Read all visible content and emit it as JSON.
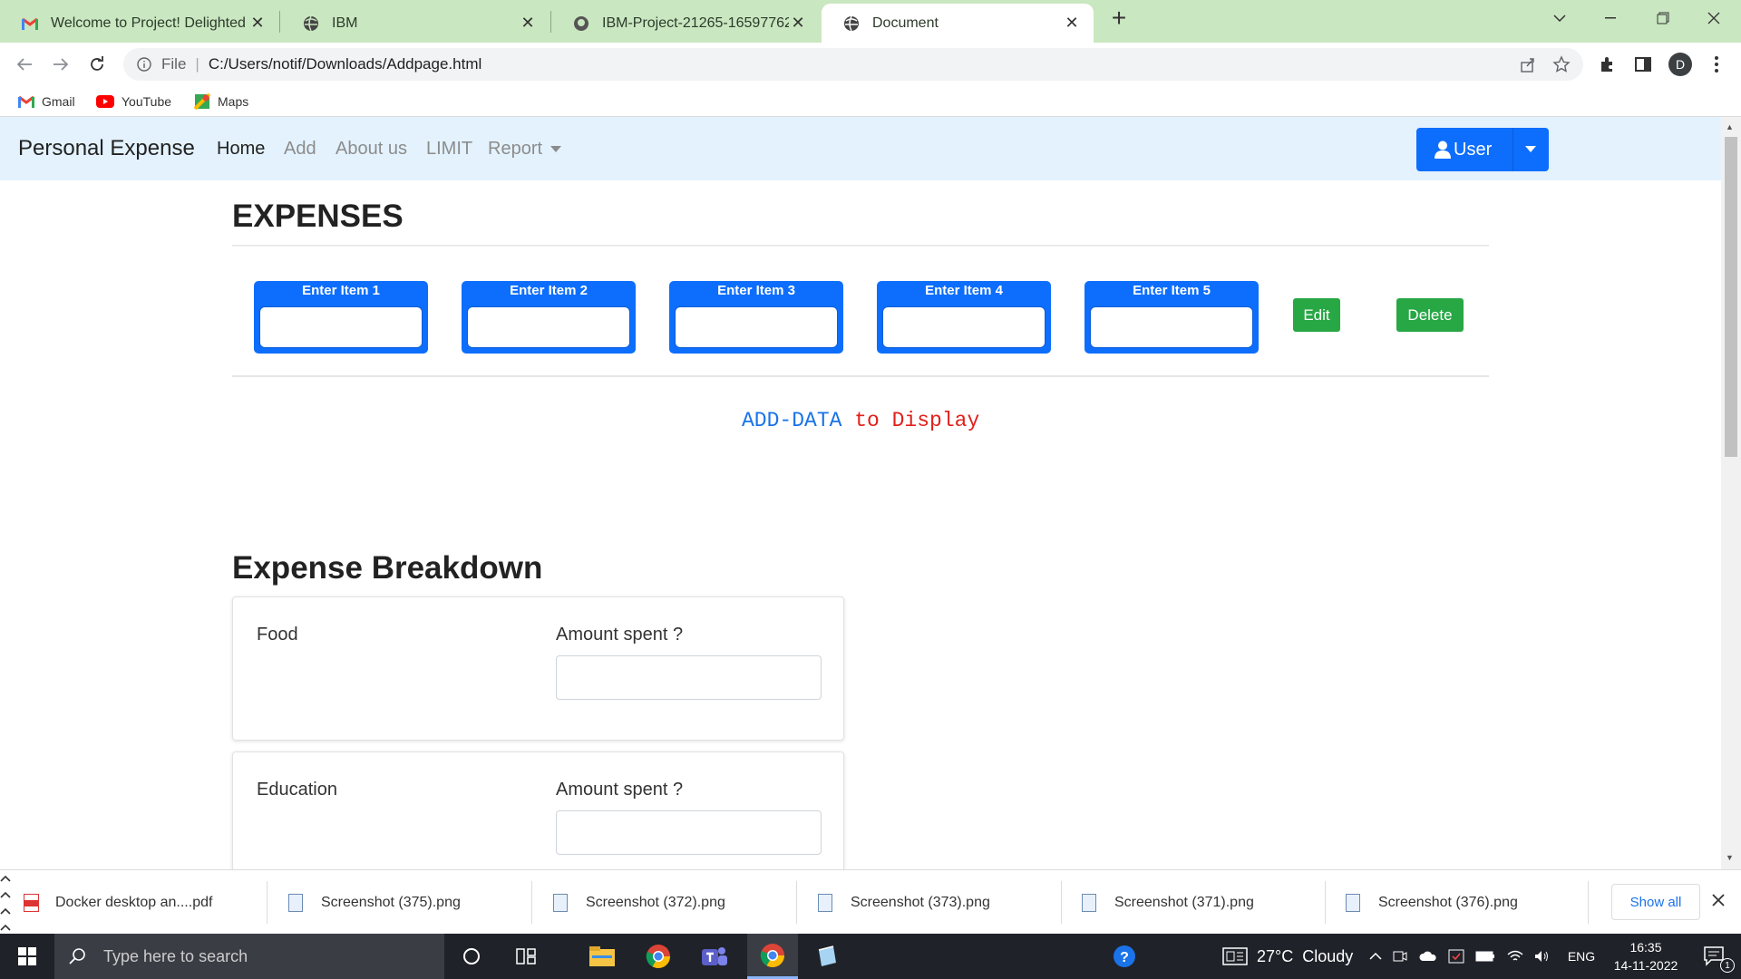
{
  "browser": {
    "tabs": [
      {
        "title": "Welcome to Project! Delighted to",
        "icon": "gmail-icon"
      },
      {
        "title": "IBM",
        "icon": "globe-icon"
      },
      {
        "title": "IBM-Project-21265-1659776205/",
        "icon": "github-icon"
      },
      {
        "title": "Document",
        "icon": "globe-icon",
        "active": true
      }
    ],
    "new_tab": "+",
    "omnibox": {
      "scheme": "File",
      "url": "C:/Users/notif/Downloads/Addpage.html"
    },
    "profile_initial": "D",
    "bookmarks": [
      {
        "label": "Gmail"
      },
      {
        "label": "YouTube"
      },
      {
        "label": "Maps"
      }
    ]
  },
  "navbar": {
    "brand": "Personal Expense",
    "links": [
      "Home",
      "Add",
      "About us",
      "LIMIT",
      "Report"
    ],
    "user_button": "User"
  },
  "page": {
    "title": "EXPENSES",
    "items": [
      "Enter Item 1",
      "Enter Item 2",
      "Enter Item 3",
      "Enter Item 4",
      "Enter Item 5"
    ],
    "edit_label": "Edit",
    "delete_label": "Delete",
    "add_data_part1": "ADD-DATA",
    "add_data_part2": " to Display",
    "breakdown_title": "Expense Breakdown",
    "breakdown": [
      {
        "category": "Food",
        "amount_label": "Amount spent ?"
      },
      {
        "category": "Education",
        "amount_label": "Amount spent ?"
      }
    ]
  },
  "downloads": {
    "items": [
      "Docker desktop an....pdf",
      "Screenshot (375).png",
      "Screenshot (372).png",
      "Screenshot (373).png",
      "Screenshot (371).png",
      "Screenshot (376).png"
    ],
    "show_all": "Show all"
  },
  "taskbar": {
    "search_placeholder": "Type here to search",
    "weather": "27°C  Cloudy",
    "language": "ENG",
    "time": "16:35",
    "date": "14-11-2022",
    "notification_count": "1"
  },
  "colors": {
    "tabstrip": "#c9e7c0",
    "navbar_bg": "#e3f2fd",
    "primary": "#0d6efd",
    "success": "#28a745",
    "add_data_blue": "#1a73e8",
    "add_data_red": "#e0201b"
  }
}
